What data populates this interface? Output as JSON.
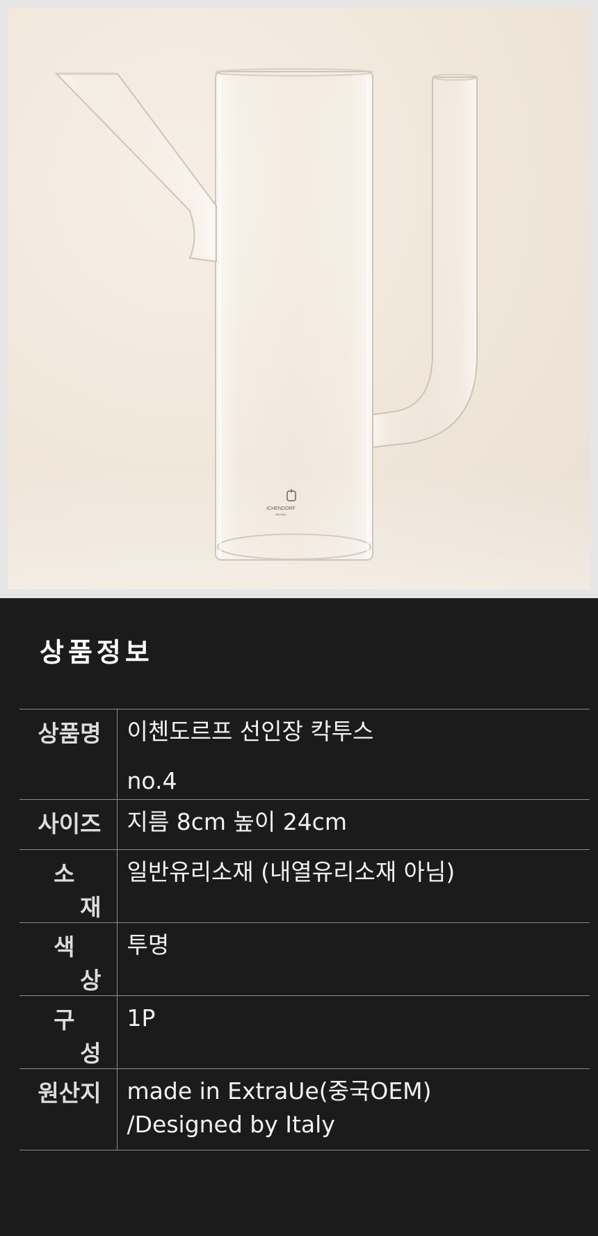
{
  "product_image": {
    "alt": "Clear glass cactus pitcher",
    "logo_text": "ICHENDORF",
    "logo_subtext": "MILANO"
  },
  "info": {
    "title": "상품정보",
    "rows": [
      {
        "label": "상품명",
        "lines": [
          "이첸도르프 선인장 칵투스",
          "no.4"
        ]
      },
      {
        "label": "사이즈",
        "lines": [
          "지름 8cm 높이 24cm"
        ]
      },
      {
        "label": "소재",
        "lines": [
          "일반유리소재 (내열유리소재 아님)"
        ]
      },
      {
        "label": "색상",
        "lines": [
          "투명"
        ]
      },
      {
        "label": "구성",
        "lines": [
          "1P"
        ]
      },
      {
        "label": "원산지",
        "lines": [
          "made in ExtraUe(중국OEM)",
          "/Designed by Italy"
        ]
      }
    ]
  }
}
